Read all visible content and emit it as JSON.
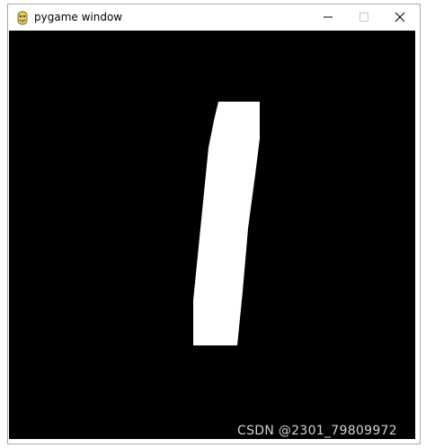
{
  "window": {
    "title": "pygame window",
    "app_icon": "pygame-snake-icon",
    "controls": {
      "minimize_icon": "minimize-icon",
      "maximize_icon": "maximize-icon",
      "close_icon": "close-icon"
    }
  },
  "canvas": {
    "background_color": "#000000",
    "shape_color": "#ffffff"
  },
  "watermark": {
    "text": "CSDN @2301_79809972"
  }
}
